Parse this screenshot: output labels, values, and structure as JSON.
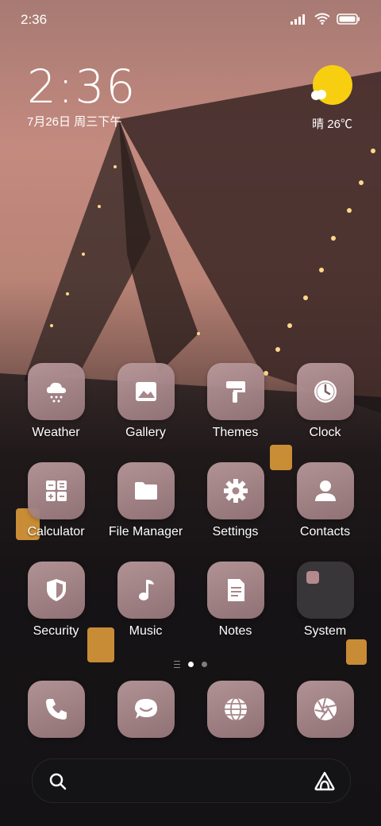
{
  "status_bar": {
    "time": "2:36"
  },
  "clock": {
    "time": "2:36",
    "date": "7月26日 周三下午"
  },
  "weather": {
    "text": "晴 26℃",
    "sun_color": "#f8cf10"
  },
  "apps": [
    {
      "label": "Weather",
      "icon": "weather-icon"
    },
    {
      "label": "Gallery",
      "icon": "gallery-icon"
    },
    {
      "label": "Themes",
      "icon": "themes-icon"
    },
    {
      "label": "Clock",
      "icon": "clock-icon"
    },
    {
      "label": "Calculator",
      "icon": "calculator-icon"
    },
    {
      "label": "File Manager",
      "icon": "folder-icon"
    },
    {
      "label": "Settings",
      "icon": "gear-icon"
    },
    {
      "label": "Contacts",
      "icon": "contacts-icon"
    },
    {
      "label": "Security",
      "icon": "shield-icon"
    },
    {
      "label": "Music",
      "icon": "music-note-icon"
    },
    {
      "label": "Notes",
      "icon": "notes-icon"
    },
    {
      "label": "System",
      "icon": "system-folder-icon"
    }
  ],
  "dock": [
    {
      "icon": "phone-icon"
    },
    {
      "icon": "messages-icon"
    },
    {
      "icon": "browser-icon"
    },
    {
      "icon": "camera-icon"
    }
  ],
  "page_indicator": {
    "current": 1,
    "total": 2
  }
}
